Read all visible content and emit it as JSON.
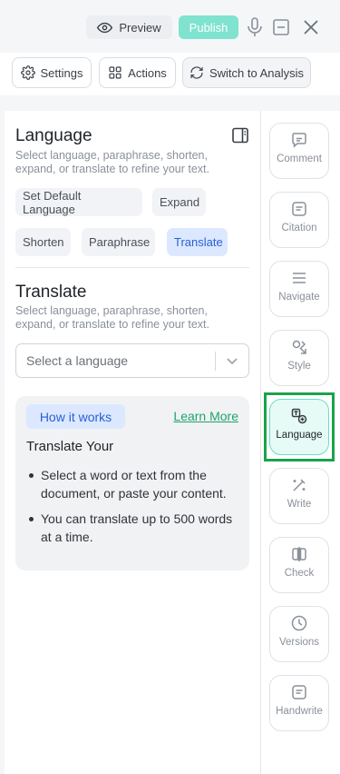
{
  "topbar": {
    "preview_label": "Preview",
    "publish_label": "Publish"
  },
  "toolbar": {
    "settings_label": "Settings",
    "actions_label": "Actions",
    "switch_label": "Switch to Analysis"
  },
  "language": {
    "title": "Language",
    "description": "Select language, paraphrase, shorten, expand, or translate to refine your text.",
    "chips": [
      {
        "label": "Set Default Language",
        "active": false
      },
      {
        "label": "Expand",
        "active": false
      },
      {
        "label": "Shorten",
        "active": false
      },
      {
        "label": "Paraphrase",
        "active": false
      },
      {
        "label": "Translate",
        "active": true
      }
    ]
  },
  "translate": {
    "title": "Translate",
    "description": "Select language, paraphrase, shorten, expand, or translate to refine your text.",
    "select_placeholder": "Select a language"
  },
  "how_it_works": {
    "badge": "How it works",
    "learn_more": "Learn More",
    "heading": "Translate Your",
    "bullets": [
      "Select a word or text from the document, or paste your content.",
      "You can translate up to 500 words at a time."
    ]
  },
  "rail": {
    "items": [
      {
        "label": "Comment",
        "icon": "comment-icon"
      },
      {
        "label": "Citation",
        "icon": "citation-icon"
      },
      {
        "label": "Navigate",
        "icon": "navigate-icon"
      },
      {
        "label": "Style",
        "icon": "style-icon"
      },
      {
        "label": "Language",
        "icon": "language-icon",
        "active": true
      },
      {
        "label": "Write",
        "icon": "write-icon"
      },
      {
        "label": "Check",
        "icon": "check-icon"
      },
      {
        "label": "Versions",
        "icon": "versions-icon"
      },
      {
        "label": "Handwrite",
        "icon": "handwrite-icon"
      }
    ]
  },
  "colors": {
    "accent_teal": "#7fe3cf",
    "chip_active_bg": "#dbe8ff",
    "chip_active_text": "#2a5fd6",
    "learn_more_green": "#1fa56a",
    "highlight_green": "#1aa34a"
  }
}
